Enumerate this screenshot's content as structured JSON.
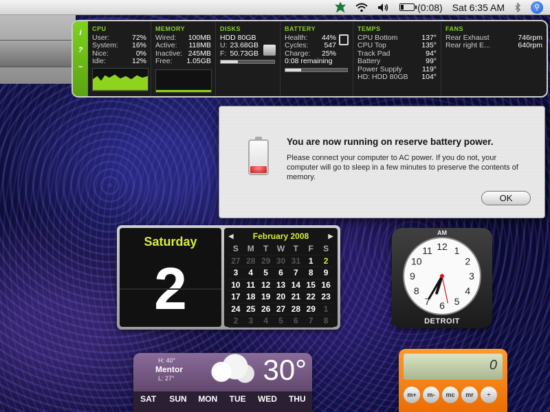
{
  "menubar": {
    "time_remaining": "(0:08)",
    "clock": "Sat 6:35 AM",
    "icons": [
      "leaf-icon",
      "wifi-icon",
      "volume-icon",
      "battery-icon",
      "bluetooth-icon",
      "spotlight-icon"
    ]
  },
  "istat": {
    "side_buttons": [
      "i",
      "?",
      "~"
    ],
    "cpu": {
      "title": "CPU",
      "rows": [
        {
          "k": "User:",
          "v": "72%"
        },
        {
          "k": "System:",
          "v": "16%"
        },
        {
          "k": "Nice:",
          "v": "0%"
        },
        {
          "k": "Idle:",
          "v": "12%"
        }
      ]
    },
    "memory": {
      "title": "MEMORY",
      "rows": [
        {
          "k": "Wired:",
          "v": "100MB"
        },
        {
          "k": "Active:",
          "v": "118MB"
        },
        {
          "k": "Inactive:",
          "v": "245MB"
        },
        {
          "k": "Free:",
          "v": "1.05GB"
        }
      ]
    },
    "disks": {
      "title": "DISKS",
      "name": "HDD 80GB",
      "rows": [
        {
          "k": "U:",
          "v": "23.68GB"
        },
        {
          "k": "F:",
          "v": "50.73GB"
        }
      ],
      "used_fraction": 0.32
    },
    "battery": {
      "title": "BATTERY",
      "rows": [
        {
          "k": "Health:",
          "v": "44%"
        },
        {
          "k": "Cycles:",
          "v": "547"
        },
        {
          "k": "Charge:",
          "v": "25%"
        }
      ],
      "remaining": "0:08 remaining",
      "charge_fraction": 0.25
    },
    "temps": {
      "title": "TEMPS",
      "rows": [
        {
          "k": "CPU Bottom",
          "v": "137°"
        },
        {
          "k": "CPU Top",
          "v": "135°"
        },
        {
          "k": "Track Pad",
          "v": "94°"
        },
        {
          "k": "Battery",
          "v": "99°"
        },
        {
          "k": "Power Supply",
          "v": "119°"
        },
        {
          "k": "HD: HDD 80GB",
          "v": "104°"
        }
      ]
    },
    "fans": {
      "title": "FANS",
      "rows": [
        {
          "k": "Rear Exhaust",
          "v": "746rpm"
        },
        {
          "k": "Rear right E...",
          "v": "640rpm"
        }
      ]
    }
  },
  "alert": {
    "title": "You are now running on reserve battery power.",
    "message": "Please connect your computer to AC power. If you do not, your computer will go to sleep in a few minutes to preserve the contents of memory.",
    "ok_label": "OK"
  },
  "calendar": {
    "day_name": "Saturday",
    "day_number": "2",
    "month_label": "February 2008",
    "weekdays": [
      "S",
      "M",
      "T",
      "W",
      "T",
      "F",
      "S"
    ],
    "weeks": [
      [
        "27",
        "28",
        "29",
        "30",
        "31",
        "1",
        "2"
      ],
      [
        "3",
        "4",
        "5",
        "6",
        "7",
        "8",
        "9"
      ],
      [
        "10",
        "11",
        "12",
        "13",
        "14",
        "15",
        "16"
      ],
      [
        "17",
        "18",
        "19",
        "20",
        "21",
        "22",
        "23"
      ],
      [
        "24",
        "25",
        "26",
        "27",
        "28",
        "29",
        "1"
      ],
      [
        "2",
        "3",
        "4",
        "5",
        "6",
        "7",
        "8"
      ]
    ],
    "today": "2"
  },
  "clock": {
    "ampm": "AM",
    "city": "DETROIT",
    "numbers": [
      "12",
      "1",
      "2",
      "3",
      "4",
      "5",
      "6",
      "7",
      "8",
      "9",
      "10",
      "11"
    ],
    "hour": 6,
    "minute": 35,
    "second": 28
  },
  "weather": {
    "hi": "H: 40°",
    "location": "Mentor",
    "lo": "L: 27°",
    "temp": "30°",
    "days": [
      "SAT",
      "SUN",
      "MON",
      "TUE",
      "WED",
      "THU"
    ]
  },
  "calculator": {
    "display": "0",
    "keys": [
      "m+",
      "m-",
      "mc",
      "mr",
      "÷"
    ]
  }
}
